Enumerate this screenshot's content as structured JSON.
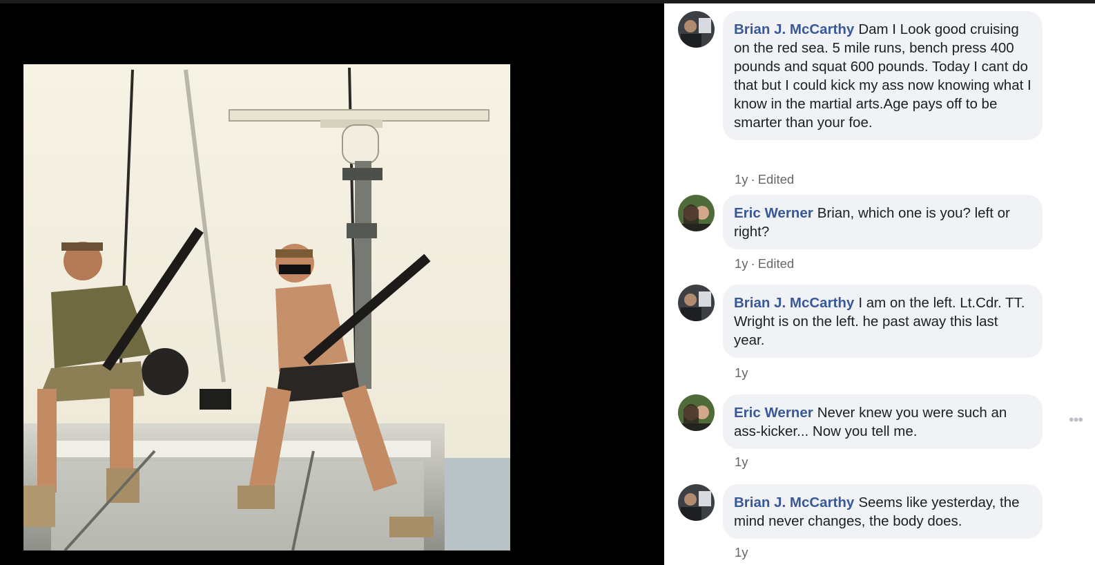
{
  "photo": {
    "subject": "photo-two-men-with-machine-guns-on-boat"
  },
  "comments": [
    {
      "author": "Brian J. McCarthy",
      "text": "Dam I Look good cruising on the red sea. 5 mile runs, bench press 400 pounds and squat 600 pounds. Today I cant do that but I could kick my ass now knowing what I know in the martial arts.Age pays off to be smarter than your foe.",
      "time": "1y",
      "edited": "Edited"
    },
    {
      "author": "Eric Werner",
      "text": "Brian, which one is you? left or right?",
      "time": "1y",
      "edited": "Edited"
    },
    {
      "author": "Brian J. McCarthy",
      "text": "I am on the left. Lt.Cdr. TT. Wright is on the left. he past away this last year.",
      "time": "1y"
    },
    {
      "author": "Eric Werner",
      "text": "Never knew you were such an ass-kicker... Now you tell me.",
      "time": "1y"
    },
    {
      "author": "Brian J. McCarthy",
      "text": "Seems like yesterday, the mind never changes, the body does.",
      "time": "1y"
    }
  ],
  "icons": {
    "more": "more-options-icon",
    "separator": "·"
  },
  "colors": {
    "author": "#385898",
    "bubble": "#f0f2f5",
    "meta": "#65676b"
  }
}
